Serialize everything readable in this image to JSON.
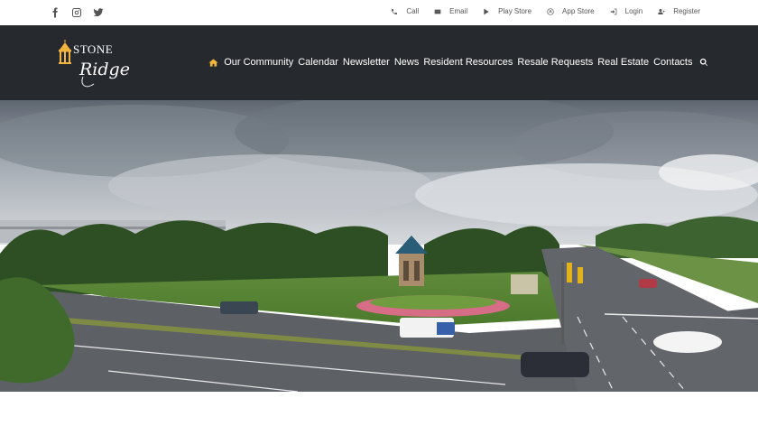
{
  "social": {
    "facebook_icon": "facebook-icon",
    "instagram_icon": "instagram-icon",
    "twitter_icon": "twitter-icon"
  },
  "utility_links": [
    {
      "label": "Call",
      "icon": "phone-icon"
    },
    {
      "label": "Email",
      "icon": "envelope-icon"
    },
    {
      "label": "Play Store",
      "icon": "play-store-icon"
    },
    {
      "label": "App Store",
      "icon": "app-store-icon"
    },
    {
      "label": "Login",
      "icon": "sign-in-icon"
    },
    {
      "label": "Register",
      "icon": "user-plus-icon"
    }
  ],
  "logo": {
    "line1": "STONE",
    "line2": "Ridge"
  },
  "nav": {
    "home_icon": "home-icon",
    "items": [
      "Our Community",
      "Calendar",
      "Newsletter",
      "News",
      "Resident Resources",
      "Resale Requests",
      "Real Estate",
      "Contacts"
    ],
    "search_icon": "search-icon"
  },
  "colors": {
    "header_bg": "#26292d",
    "accent": "#f1b53d",
    "topbar_text": "#555555"
  }
}
